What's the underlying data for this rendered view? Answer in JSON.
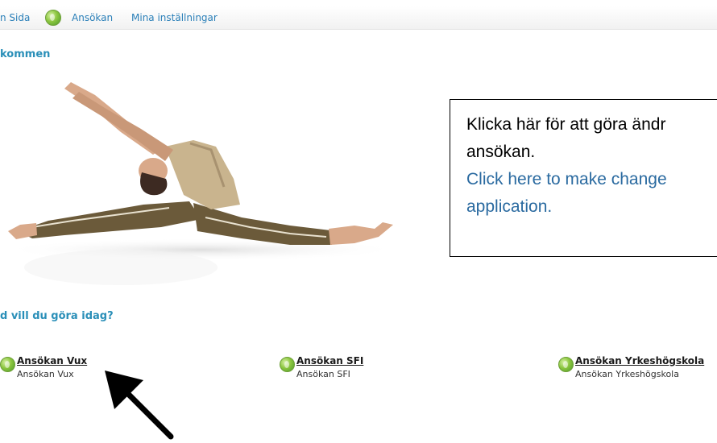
{
  "nav": {
    "items": [
      {
        "label": "n Sida"
      },
      {
        "label": "Ansökan"
      },
      {
        "label": "Mina inställningar"
      }
    ]
  },
  "welcome": {
    "heading": "kommen"
  },
  "callout": {
    "swedish_line1": "Klicka här för att göra ändr",
    "swedish_line2": "ansökan.",
    "english_line1": "Click here to make change",
    "english_line2": "application."
  },
  "tasks": {
    "heading": "d vill du göra idag?",
    "items": [
      {
        "title": "Ansökan Vux",
        "subtitle": "Ansökan Vux"
      },
      {
        "title": "Ansökan SFI",
        "subtitle": "Ansökan SFI"
      },
      {
        "title": "Ansökan Yrkeshögskola",
        "subtitle": "Ansökan Yrkeshögskola"
      }
    ]
  },
  "colors": {
    "link": "#2a7fb8",
    "heading": "#2a8fb8",
    "globe": "#8cc63f",
    "callout_en": "#2a6aa0"
  }
}
